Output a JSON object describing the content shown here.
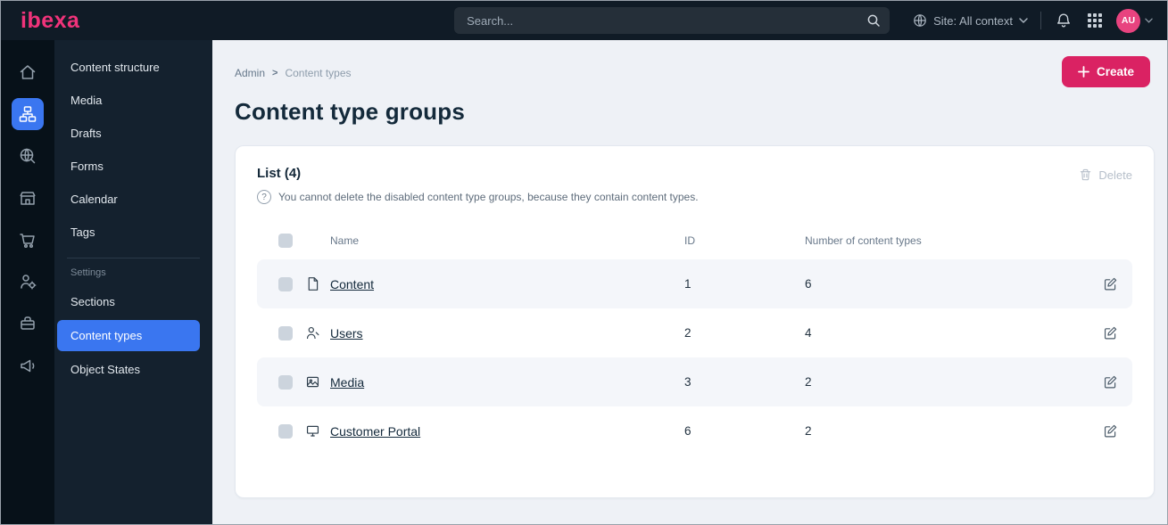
{
  "topbar": {
    "logo_text": "ibexa",
    "search_placeholder": "Search...",
    "site_context_label": "Site: All context",
    "avatar_initials": "AU",
    "icons": [
      "search-icon",
      "globe-icon",
      "chevron-down-icon",
      "bell-icon",
      "app-grid-icon"
    ]
  },
  "rail": {
    "items": [
      {
        "icon": "home-icon",
        "active": false
      },
      {
        "icon": "content-structure-icon",
        "active": true
      },
      {
        "icon": "site-search-icon",
        "active": false
      },
      {
        "icon": "commerce-icon",
        "active": false
      },
      {
        "icon": "cart-icon",
        "active": false
      },
      {
        "icon": "roles-icon",
        "active": false
      },
      {
        "icon": "admin-icon",
        "active": false
      },
      {
        "icon": "marketing-icon",
        "active": false
      }
    ]
  },
  "sidebar": {
    "items": [
      {
        "label": "Content structure"
      },
      {
        "label": "Media"
      },
      {
        "label": "Drafts"
      },
      {
        "label": "Forms"
      },
      {
        "label": "Calendar"
      },
      {
        "label": "Tags"
      }
    ],
    "settings_heading": "Settings",
    "settings_items": [
      {
        "label": "Sections",
        "active": false
      },
      {
        "label": "Content types",
        "active": true
      },
      {
        "label": "Object States",
        "active": false
      }
    ]
  },
  "main": {
    "breadcrumb": {
      "items": [
        "Admin",
        "Content types"
      ],
      "separator": ">"
    },
    "create_button_label": "Create",
    "create_button_icon": "plus-icon",
    "page_title": "Content type groups",
    "card": {
      "list_heading": "List (4)",
      "info_icon_glyph": "?",
      "info_text": "You cannot delete the disabled content type groups, because they contain content types.",
      "delete_button_label": "Delete",
      "delete_button_icon": "trash-icon",
      "table": {
        "columns": [
          "Name",
          "ID",
          "Number of content types"
        ],
        "rows": [
          {
            "icon": "file-icon",
            "name": "Content",
            "id": "1",
            "count": "6"
          },
          {
            "icon": "user-icon",
            "name": "Users",
            "id": "2",
            "count": "4"
          },
          {
            "icon": "image-icon",
            "name": "Media",
            "id": "3",
            "count": "2"
          },
          {
            "icon": "monitor-icon",
            "name": "Customer Portal",
            "id": "6",
            "count": "2"
          }
        ]
      }
    }
  },
  "colors": {
    "accent_pink": "#da2263",
    "accent_blue": "#3a76f0",
    "topbar_bg": "#101b26",
    "row_alt_bg": "#f4f6fa"
  }
}
